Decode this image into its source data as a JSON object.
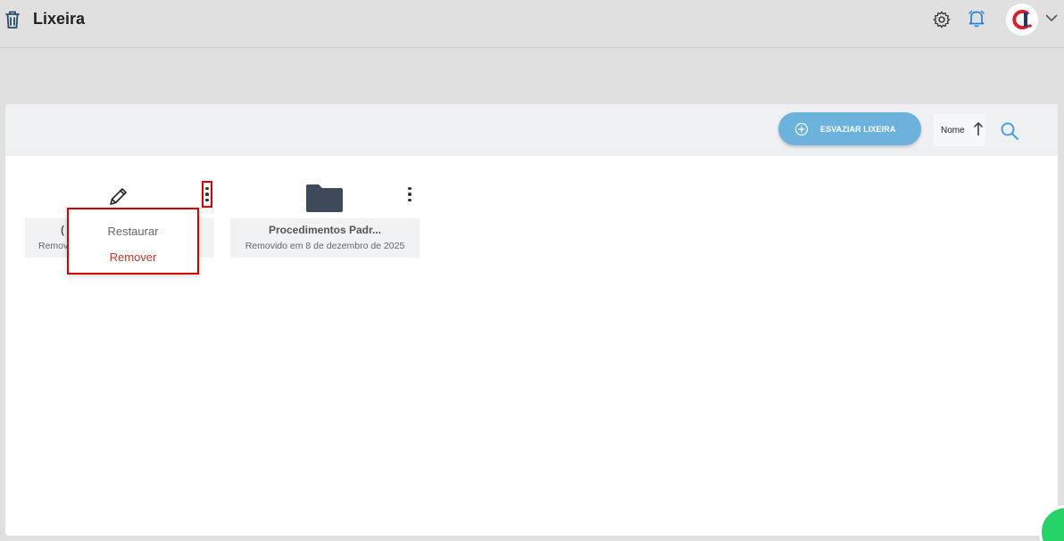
{
  "header": {
    "title": "Lixeira",
    "icons": [
      "trash-icon",
      "gear-icon",
      "bell-icon",
      "chevron-down-icon"
    ]
  },
  "toolbar": {
    "empty_button": "ESVAZIAR LIXEIRA",
    "sort_label": "Nome"
  },
  "items": [
    {
      "name": "(",
      "subtitle": "Remov",
      "icon": "pencil-icon"
    },
    {
      "name": "Procedimentos Padr...",
      "subtitle": "Removido em 8 de dezembro de 2025",
      "icon": "folder-icon"
    }
  ],
  "context_menu": {
    "restore": "Restaurar",
    "remove": "Remover"
  },
  "colors": {
    "accent": "#6bb3dc",
    "danger": "#d40000",
    "folder": "#3e4a5a",
    "notification": "#2a7de1"
  }
}
